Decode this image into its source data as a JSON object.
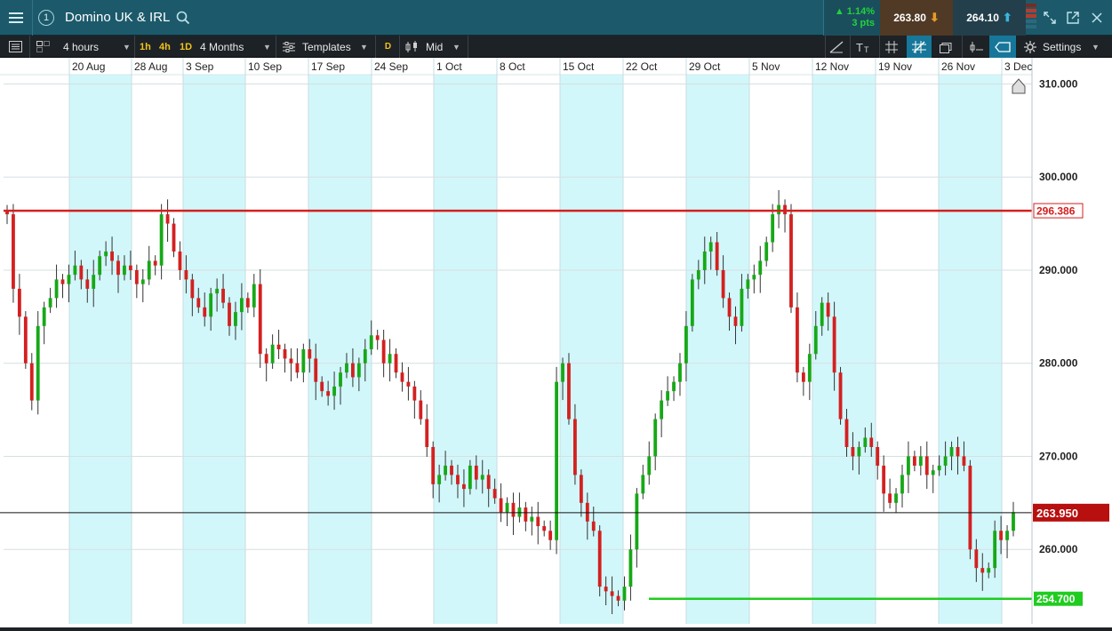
{
  "header": {
    "window_number": "1",
    "instrument": "Domino UK & IRL",
    "change_pct": "▲ 1.14%",
    "change_pts": "3 pts",
    "sell_price": "263.80",
    "buy_price": "264.10",
    "colors": {
      "up": "#22d33a",
      "sell_bg": "#503a25",
      "buy_bg": "#233f4b"
    }
  },
  "toolbar": {
    "interval": "4 hours",
    "quick_1h": "1h",
    "quick_4h": "4h",
    "quick_1d": "1D",
    "range": "4 Months",
    "templates": "Templates",
    "d_badge": "D",
    "price_type": "Mid",
    "settings": "Settings"
  },
  "chart_data": {
    "type": "candlestick",
    "x_tick_labels": [
      "20 Aug",
      "28 Aug",
      "3 Sep",
      "10 Sep",
      "17 Sep",
      "24 Sep",
      "1 Oct",
      "8 Oct",
      "15 Oct",
      "22 Oct",
      "29 Oct",
      "5 Nov",
      "12 Nov",
      "19 Nov",
      "26 Nov",
      "3 Dec"
    ],
    "y_tick_labels": [
      "310.000",
      "300.000",
      "290.000",
      "280.000",
      "270.000",
      "260.000"
    ],
    "ylim": [
      251,
      312
    ],
    "horizontal_lines": [
      {
        "label": "296.386",
        "value": 296.386,
        "color": "#d42020"
      },
      {
        "label": "263.950",
        "value": 263.95,
        "color": "#111111",
        "badge_color": "#b80f0f"
      },
      {
        "label": "254.700",
        "value": 254.7,
        "color": "#1fcc1f"
      }
    ],
    "up_color": "#17a817",
    "down_color": "#d42020",
    "closes": [
      296.0,
      288.0,
      285.0,
      280.0,
      276.0,
      284.0,
      286.0,
      287.0,
      289.0,
      288.5,
      289.5,
      290.5,
      289.0,
      288.0,
      289.5,
      291.5,
      292.0,
      291.0,
      289.5,
      290.5,
      290.0,
      288.5,
      289.0,
      291.0,
      290.5,
      296.0,
      295.0,
      292.0,
      290.0,
      289.0,
      287.0,
      286.0,
      285.0,
      287.5,
      288.0,
      286.5,
      284.0,
      285.5,
      287.0,
      286.0,
      288.5,
      281.0,
      280.0,
      282.0,
      281.5,
      280.5,
      280.0,
      279.0,
      281.5,
      280.5,
      278.0,
      277.0,
      276.5,
      277.5,
      279.0,
      280.0,
      278.5,
      280.0,
      281.5,
      283.0,
      282.5,
      280.0,
      281.0,
      279.0,
      278.0,
      277.5,
      276.0,
      274.0,
      271.0,
      267.0,
      268.0,
      269.0,
      268.0,
      267.0,
      266.5,
      269.0,
      267.5,
      268.0,
      266.5,
      265.5,
      264.0,
      265.0,
      263.5,
      264.5,
      263.0,
      263.5,
      262.5,
      262.0,
      261.0,
      278.0,
      280.0,
      274.0,
      268.0,
      265.0,
      263.0,
      262.0,
      256.0,
      255.5,
      255.0,
      254.5,
      256.0,
      260.0,
      266.0,
      268.0,
      270.0,
      274.0,
      276.0,
      277.0,
      278.0,
      280.0,
      284.0,
      289.0,
      290.0,
      292.0,
      293.0,
      290.0,
      287.0,
      285.0,
      284.0,
      288.0,
      289.0,
      289.5,
      291.0,
      293.0,
      296.0,
      297.0,
      296.0,
      286.0,
      279.0,
      278.0,
      281.0,
      284.0,
      286.5,
      285.0,
      279.0,
      274.0,
      271.0,
      270.0,
      271.0,
      272.0,
      271.0,
      269.0,
      266.0,
      265.0,
      266.0,
      268.0,
      270.0,
      269.0,
      270.0,
      268.0,
      268.5,
      269.0,
      270.0,
      271.0,
      270.0,
      269.0,
      260.0,
      258.0,
      257.5,
      258.0,
      262.0,
      261.0,
      262.0,
      264.0
    ]
  }
}
